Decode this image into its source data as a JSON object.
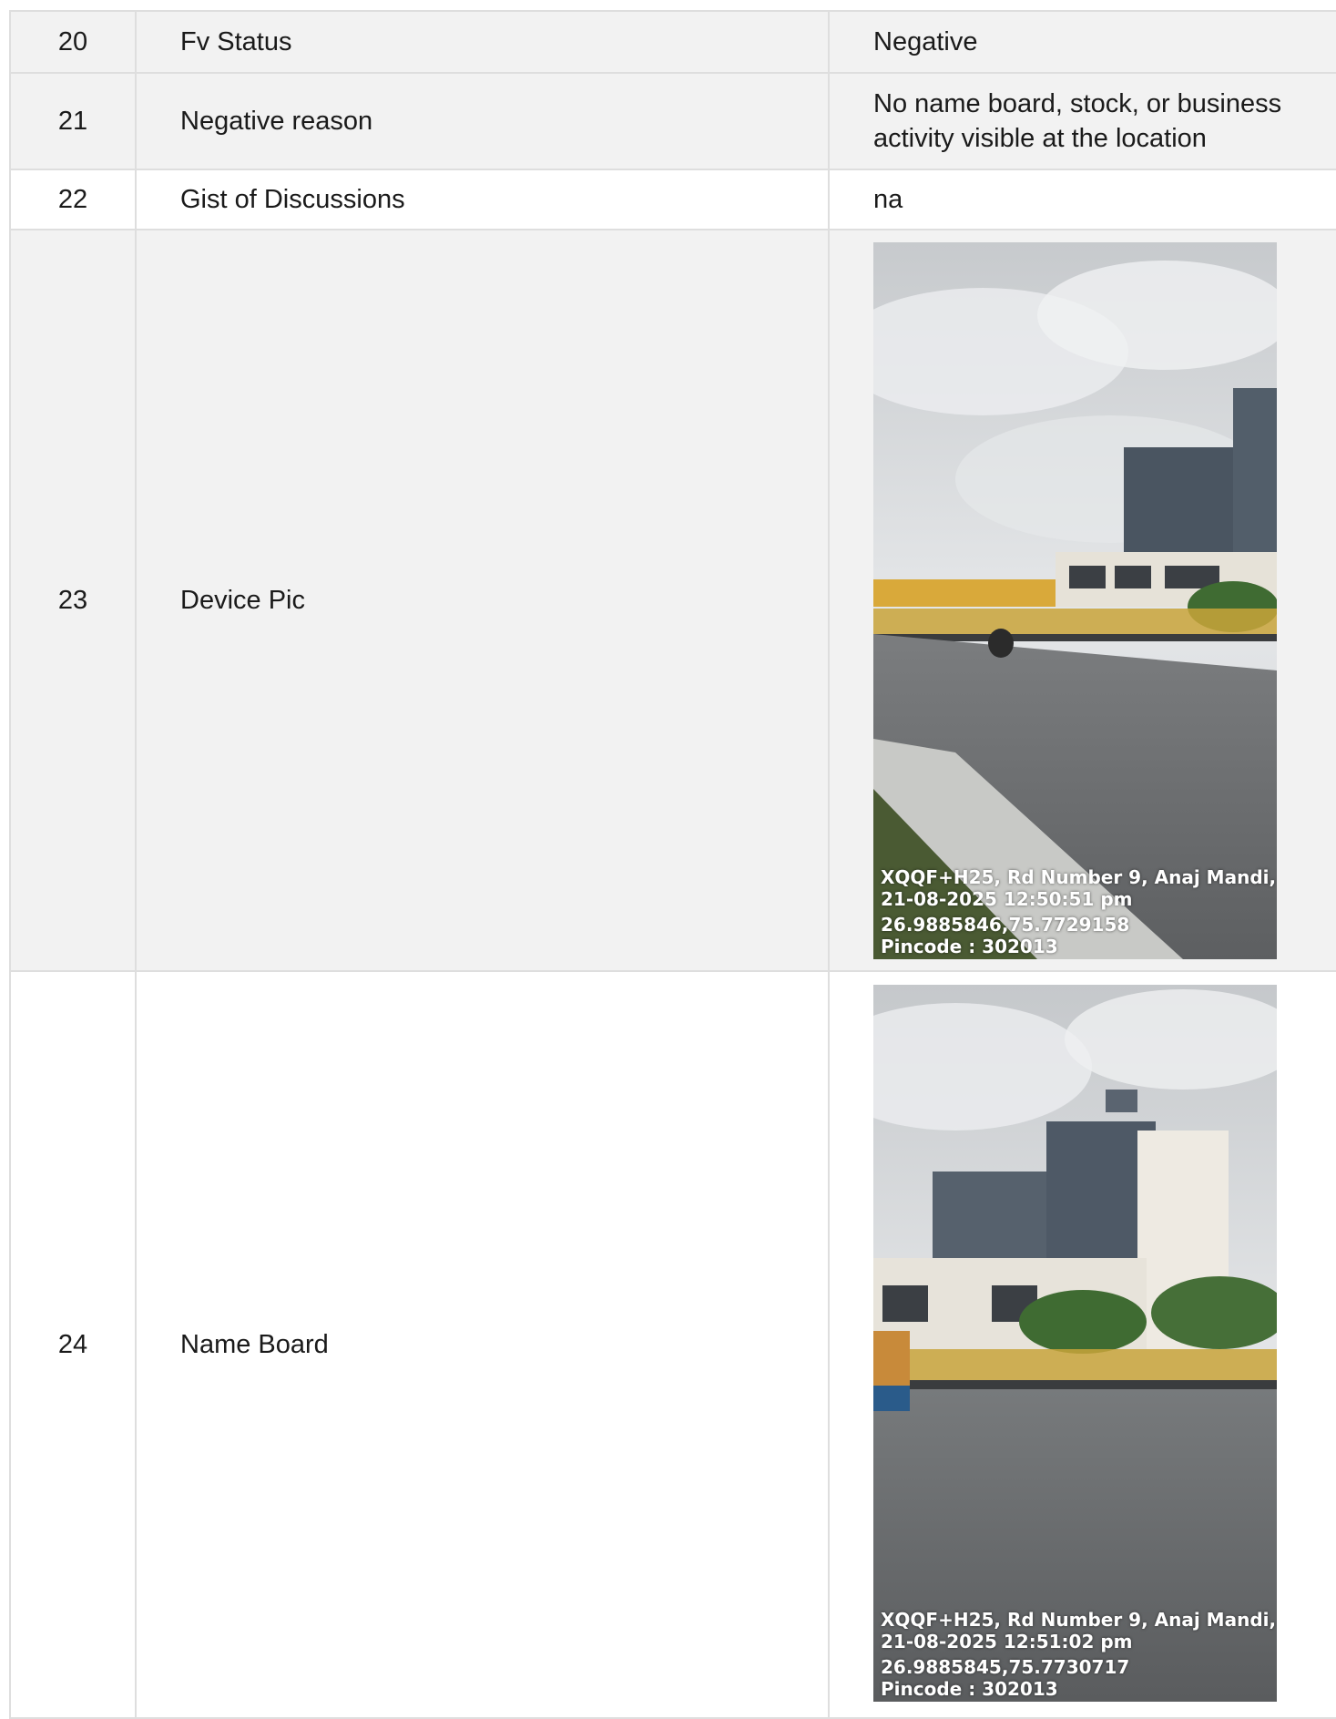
{
  "rows": [
    {
      "num": "20",
      "label": "Fv Status",
      "value_lines": [
        "Negative"
      ]
    },
    {
      "num": "21",
      "label": "Negative reason",
      "value_lines": [
        "No name board, stock, or business",
        "activity visible at the location"
      ]
    },
    {
      "num": "22",
      "label": "Gist of Discussions",
      "value_lines": [
        "na"
      ]
    },
    {
      "num": "23",
      "label": "Device Pic",
      "photo": {
        "address": "XQQF+H25, Rd Number 9, Anaj Mandi, ...",
        "datetime": "21-08-2025 12:50:51 pm",
        "coords": "26.9885846,75.7729158",
        "pincode": "Pincode : 302013"
      }
    },
    {
      "num": "24",
      "label": "Name Board",
      "photo": {
        "address": "XQQF+H25, Rd Number 9, Anaj Mandi, ...",
        "datetime": "21-08-2025 12:51:02 pm",
        "coords": "26.9885845,75.7730717",
        "pincode": "Pincode : 302013"
      }
    }
  ],
  "colors": {
    "shaded_row": "#f2f2f2",
    "border": "#dedede",
    "sky": "#d9dcdf",
    "road": "#6b6d6f",
    "building_glass": "#4a5561",
    "railing": "#c9a53a",
    "foliage": "#3f6b32"
  }
}
